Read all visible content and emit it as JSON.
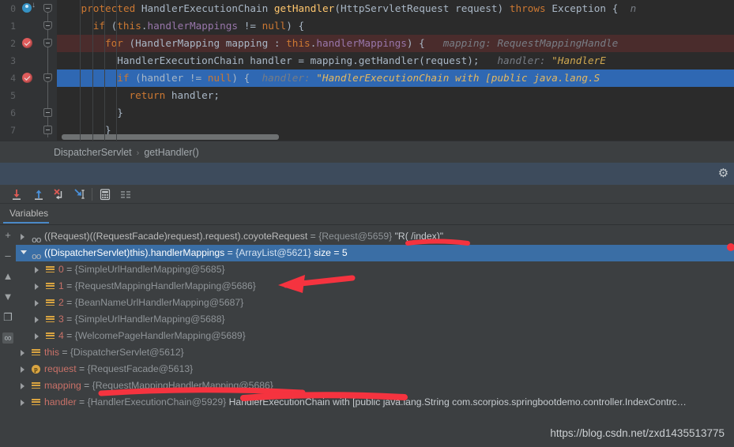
{
  "editor": {
    "line_numbers": [
      "0",
      "1",
      "2",
      "3",
      "4",
      "5",
      "6",
      "7"
    ],
    "lines": [
      {
        "n": "0",
        "indent": 4,
        "tokens": [
          {
            "t": "protected ",
            "c": "kw"
          },
          {
            "t": "HandlerExecutionChain ",
            "c": "ty"
          },
          {
            "t": "getHandler",
            "c": "fn"
          },
          {
            "t": "(HttpServletRequest request) ",
            "c": "op"
          },
          {
            "t": "throws ",
            "c": "kw"
          },
          {
            "t": "Exception { ",
            "c": "ty"
          },
          {
            "t": " n",
            "c": "hint"
          }
        ]
      },
      {
        "n": "1",
        "indent": 6,
        "tokens": [
          {
            "t": "if ",
            "c": "kw"
          },
          {
            "t": "(",
            "c": "op"
          },
          {
            "t": "this",
            "c": "kw"
          },
          {
            "t": ".",
            "c": "op"
          },
          {
            "t": "handlerMappings",
            "c": "fld"
          },
          {
            "t": " != ",
            "c": "op"
          },
          {
            "t": "null",
            "c": "kw"
          },
          {
            "t": ") {",
            "c": "op"
          }
        ]
      },
      {
        "n": "2",
        "indent": 8,
        "highlight": "red",
        "tokens": [
          {
            "t": "for ",
            "c": "kw"
          },
          {
            "t": "(HandlerMapping mapping : ",
            "c": "op"
          },
          {
            "t": "this",
            "c": "kw"
          },
          {
            "t": ".",
            "c": "op"
          },
          {
            "t": "handlerMappings",
            "c": "fld"
          },
          {
            "t": ") {",
            "c": "op"
          },
          {
            "t": "   mapping:",
            "c": "hint"
          },
          {
            "t": " RequestMappingHandle",
            "c": "hint"
          }
        ]
      },
      {
        "n": "3",
        "indent": 10,
        "tokens": [
          {
            "t": "HandlerExecutionChain handler = mapping.getHandler(request);",
            "c": "op"
          },
          {
            "t": "   handler:",
            "c": "hint"
          },
          {
            "t": " \"HandlerE",
            "c": "hintv"
          }
        ]
      },
      {
        "n": "4",
        "indent": 10,
        "highlight": "blue",
        "tokens": [
          {
            "t": "if ",
            "c": "kw"
          },
          {
            "t": "(handler != ",
            "c": "op"
          },
          {
            "t": "null",
            "c": "kw"
          },
          {
            "t": ") {",
            "c": "op"
          },
          {
            "t": "  handler:",
            "c": "hint"
          },
          {
            "t": " \"HandlerExecutionChain with [public java.lang.S",
            "c": "hintv2"
          }
        ]
      },
      {
        "n": "5",
        "indent": 12,
        "tokens": [
          {
            "t": "return ",
            "c": "kw"
          },
          {
            "t": "handler;",
            "c": "op"
          }
        ]
      },
      {
        "n": "6",
        "indent": 10,
        "tokens": [
          {
            "t": "}",
            "c": "op"
          }
        ]
      },
      {
        "n": "7",
        "indent": 8,
        "tokens": [
          {
            "t": "}",
            "c": "op"
          }
        ]
      }
    ]
  },
  "breadcrumb": {
    "class_name": "DispatcherServlet",
    "separator": "›",
    "method_name": "getHandler()"
  },
  "debug_bar": {
    "gear_icon": "gear-icon"
  },
  "toolbar": {
    "buttons": [
      {
        "name": "step-over-icon",
        "title": "Step Over"
      },
      {
        "name": "step-out-icon",
        "title": "Step Out"
      },
      {
        "name": "force-step-into-icon",
        "title": "Force Step Into"
      },
      {
        "name": "run-to-cursor-icon",
        "title": "Run to Cursor"
      },
      {
        "name": "evaluate-expression-icon",
        "title": "Evaluate Expression"
      },
      {
        "name": "layout-settings-icon",
        "title": "Layout Settings"
      }
    ]
  },
  "variables_tab": {
    "label": "Variables"
  },
  "left_rail": {
    "buttons": [
      {
        "name": "add-watch-button",
        "glyph": "+"
      },
      {
        "name": "remove-watch-button",
        "glyph": "–"
      },
      {
        "name": "move-up-button",
        "glyph": "▲"
      },
      {
        "name": "move-down-button",
        "glyph": "▼"
      },
      {
        "name": "copy-value-button",
        "glyph": "❐"
      },
      {
        "name": "inspect-button",
        "glyph": "∞"
      }
    ]
  },
  "variables": [
    {
      "indent": 0,
      "expander": "right",
      "icon": "oo",
      "name": "((Request)((RequestFacade)request).request).coyoteRequest",
      "eq": " = ",
      "value": "{Request@5659}",
      "extra": " \"R( /index)\"",
      "selected": false
    },
    {
      "indent": 0,
      "expander": "down",
      "icon": "oo",
      "name": "((DispatcherServlet)this).handlerMappings",
      "eq": " = ",
      "value": "{ArrayList@5621}",
      "extra": "  size = 5",
      "selected": true
    },
    {
      "indent": 1,
      "expander": "right",
      "icon": "list",
      "name": "0",
      "name_style": "index",
      "eq": " = ",
      "value": "{SimpleUrlHandlerMapping@5685}",
      "extra": "",
      "selected": false
    },
    {
      "indent": 1,
      "expander": "right",
      "icon": "list",
      "name": "1",
      "name_style": "index",
      "eq": " = ",
      "value": "{RequestMappingHandlerMapping@5686}",
      "extra": "",
      "selected": false
    },
    {
      "indent": 1,
      "expander": "right",
      "icon": "list",
      "name": "2",
      "name_style": "index",
      "eq": " = ",
      "value": "{BeanNameUrlHandlerMapping@5687}",
      "extra": "",
      "selected": false
    },
    {
      "indent": 1,
      "expander": "right",
      "icon": "list",
      "name": "3",
      "name_style": "index",
      "eq": " = ",
      "value": "{SimpleUrlHandlerMapping@5688}",
      "extra": "",
      "selected": false
    },
    {
      "indent": 1,
      "expander": "right",
      "icon": "list",
      "name": "4",
      "name_style": "index",
      "eq": " = ",
      "value": "{WelcomePageHandlerMapping@5689}",
      "extra": "",
      "selected": false
    },
    {
      "indent": 0,
      "expander": "right",
      "icon": "list",
      "name": "this",
      "name_style": "red",
      "eq": " = ",
      "value": "{DispatcherServlet@5612}",
      "extra": "",
      "selected": false
    },
    {
      "indent": 0,
      "expander": "right",
      "icon": "p",
      "name": "request",
      "name_style": "red",
      "eq": " = ",
      "value": "{RequestFacade@5613}",
      "extra": "",
      "selected": false
    },
    {
      "indent": 0,
      "expander": "right",
      "icon": "list",
      "name": "mapping",
      "name_style": "red",
      "eq": " = ",
      "value": "{RequestMappingHandlerMapping@5686}",
      "extra": "",
      "selected": false
    },
    {
      "indent": 0,
      "expander": "right",
      "icon": "list",
      "name": "handler",
      "name_style": "red",
      "eq": " = ",
      "value": "{HandlerExecutionChain@5929}",
      "extra": "  HandlerExecutionChain with [public java.lang.String com.scorpios.springbootdemo.controller.IndexContrc…",
      "selected": false
    }
  ],
  "annotations": {
    "color": "#f5333f",
    "items": [
      {
        "name": "underline-coyote-request-value"
      },
      {
        "name": "arrow-to-request-mapping-handler-mapping"
      },
      {
        "name": "underline-mapping-value"
      }
    ]
  },
  "watermark": {
    "text": "https://blog.csdn.net/zxd1435513775"
  }
}
